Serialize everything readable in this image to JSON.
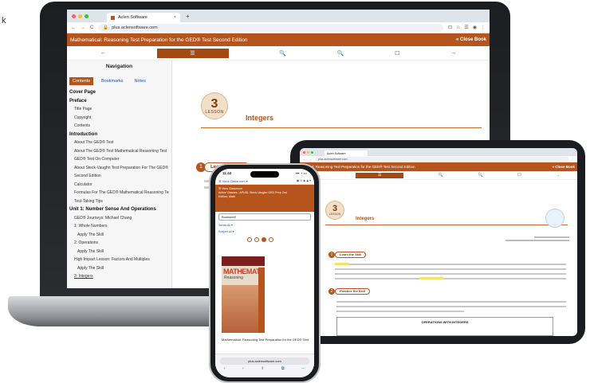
{
  "page_edge": {
    "left_fragment": "k"
  },
  "laptop": {
    "browser": {
      "tab_title": "Aclen Software",
      "tab_close": "×",
      "new_tab": "+",
      "url": "plus.aclensoftware.com",
      "nav_glyphs": [
        "←",
        "→",
        "C"
      ],
      "toolbar_glyphs": [
        "⊡",
        "☆",
        "☰",
        "◉",
        "⋮"
      ]
    },
    "app": {
      "title": "Mathematical: Reasoning Test Preparation for the GED® Test Second Edition",
      "close_label": "« Close Book",
      "toolbar": [
        "←",
        "☰",
        "🔍",
        "🔍",
        "☐",
        "→"
      ]
    },
    "navigation": {
      "title": "Navigation",
      "tabs": [
        "Contents",
        "Bookmarks",
        "Notes"
      ],
      "items": [
        {
          "label": "Cover Page",
          "level": "h"
        },
        {
          "label": "Preface",
          "level": "h"
        },
        {
          "label": "Title Page",
          "level": "i1"
        },
        {
          "label": "Copyright",
          "level": "i1"
        },
        {
          "label": "Contents",
          "level": "i1"
        },
        {
          "label": "Introduction",
          "level": "h"
        },
        {
          "label": "About The GED® Test",
          "level": "i1"
        },
        {
          "label": "About The GED® Test Mathematical Reasoning Test",
          "level": "i1"
        },
        {
          "label": "GED® Test On Computer",
          "level": "i1"
        },
        {
          "label": "About Steck-Vaughn Test Preparation For The GED® Test,",
          "level": "i1"
        },
        {
          "label": "Second Edition",
          "level": "i1"
        },
        {
          "label": "Calculator",
          "level": "i1"
        },
        {
          "label": "Formulas For The GED® Mathematical Reasoning Test",
          "level": "i1"
        },
        {
          "label": "Test-Taking Tips",
          "level": "i1"
        },
        {
          "label": "Unit 1: Number Sense And Operations",
          "level": "h"
        },
        {
          "label": "GED® Journeys: Michael Chang",
          "level": "i1"
        },
        {
          "label": "1: Whole Numbers",
          "level": "i1"
        },
        {
          "label": "Apply The Skill",
          "level": "i2"
        },
        {
          "label": "2: Operations",
          "level": "i1"
        },
        {
          "label": "Apply The Skill",
          "level": "i2"
        },
        {
          "label": "High Impact Lesson: Factors And Multiples",
          "level": "i1"
        },
        {
          "label": "Apply The Skill",
          "level": "i2"
        },
        {
          "label": "3: Integers",
          "level": "i1u"
        }
      ]
    },
    "lesson": {
      "number": "3",
      "word": "LESSON",
      "title": "Integers",
      "learn": "Learn the Skill",
      "learn_num": "1"
    }
  },
  "tablet": {
    "tab_title": "Aclen Software",
    "url": "plus.aclensoftware.com",
    "app_title": "matical: Reasoning Test Preparation for the GED® Test Second Edition",
    "close_label": "« Close Book",
    "toolbar": [
      "←",
      "☰",
      "🔍",
      "🔍",
      "☐",
      "→"
    ],
    "lesson_number": "3",
    "lesson_word": "LESSON",
    "lesson_title": "Integers",
    "learn": "Learn the Skill",
    "learn_num": "1",
    "practice": "Practice the Skill",
    "practice_num": "2",
    "table_header": "OPERATIONS WITH INTEGERS"
  },
  "phone": {
    "time": "11:43",
    "status_icons": "▪▪▪ ◔ ▭",
    "menu_label": "☰ View Classroom ▾",
    "banner": "☰ View Classroom\nActive Classes ; APUSL Steck-Vaughn GED Prep 2nd\nEdition; Math",
    "bookshelf": "Bookshelf",
    "filter1": "Series All ▾",
    "filter2": "Subject All ▾",
    "cover_title": "MATHEMATICAL",
    "cover_sub": "Reasoning",
    "book_title": "Mathematical: Reasoning Test Preparation for the GED® Test",
    "address": "plus.aclensoftware.com",
    "nav": [
      "‹",
      "›",
      "⇪",
      "⧉",
      "⋯"
    ]
  }
}
